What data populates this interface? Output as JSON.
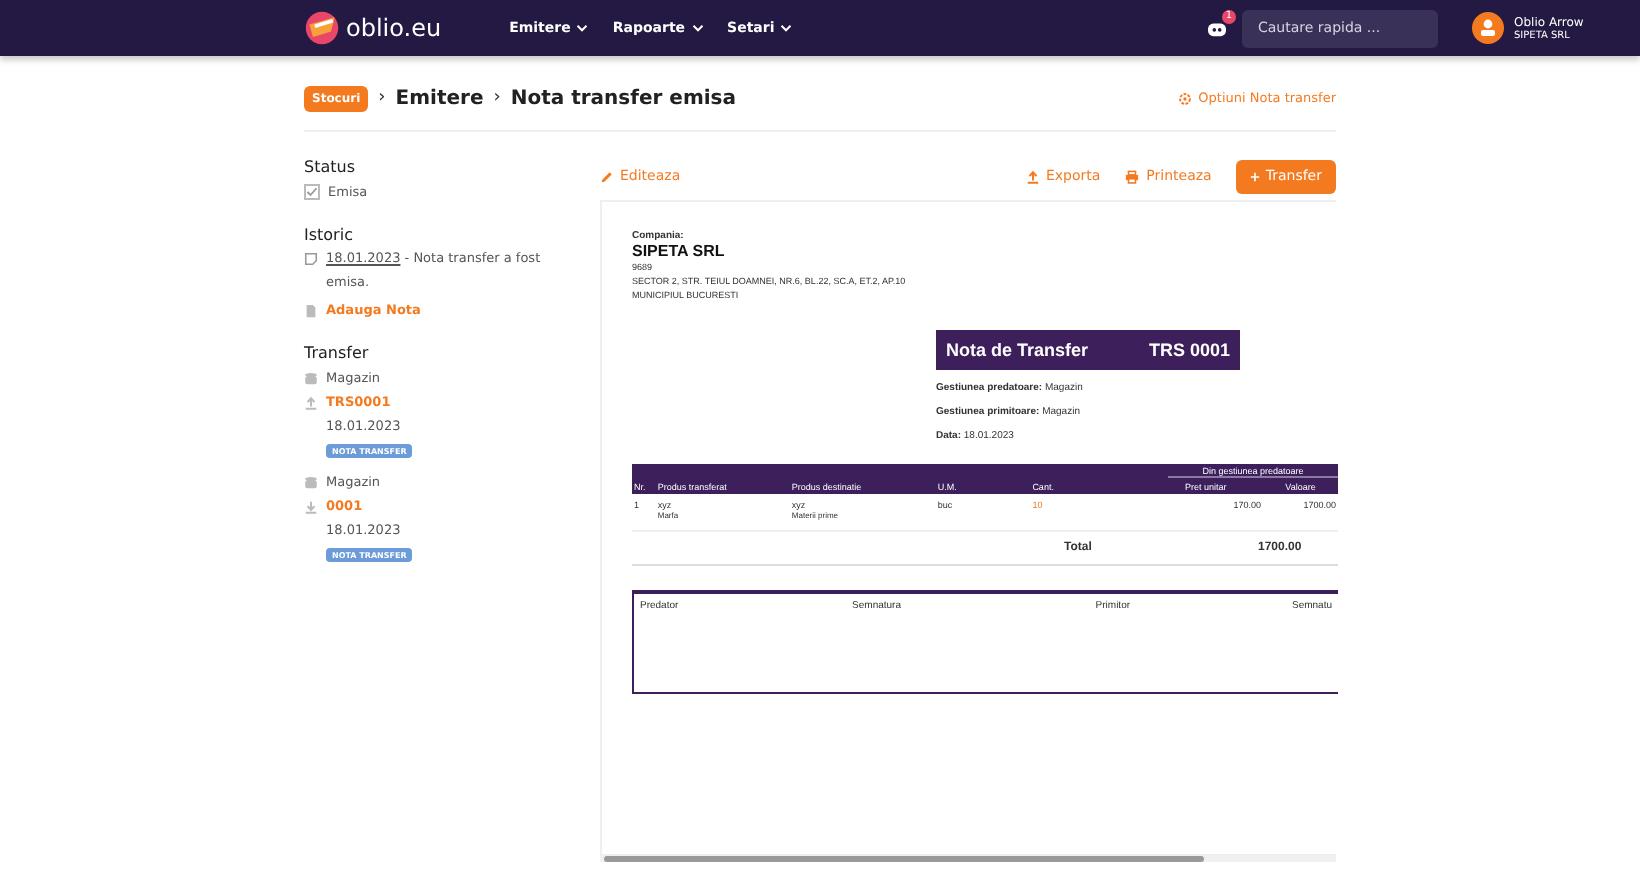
{
  "navbar": {
    "logo": "oblio.eu",
    "menus": [
      {
        "label": "Emitere"
      },
      {
        "label": "Rapoarte"
      },
      {
        "label": "Setari"
      }
    ],
    "notification_count": "1",
    "search": {
      "placeholder": "Cautare rapida ..."
    },
    "user": {
      "name": "Oblio Arrow",
      "company": "SIPETA SRL"
    }
  },
  "breadcrumb": {
    "badge": "Stocuri",
    "separator": "›",
    "items": [
      "Emitere",
      "Nota transfer emisa"
    ],
    "options_link": "Optiuni Nota transfer"
  },
  "sidebar": {
    "status": {
      "title": "Status",
      "label": "Emisa",
      "checked": true
    },
    "history": {
      "title": "Istoric",
      "date": "18.01.2023",
      "text": " - Nota transfer a fost emisa.",
      "add_note": "Adauga Nota"
    },
    "transfer": {
      "title": "Transfer",
      "entries": [
        {
          "store": "Magazin",
          "kind": "out",
          "number": "TRS0001",
          "date": "18.01.2023",
          "tag": "NOTA TRANSFER"
        },
        {
          "store": "Magazin",
          "kind": "in",
          "number": "0001",
          "date": "18.01.2023",
          "tag": "NOTA TRANSFER"
        }
      ]
    }
  },
  "toolbar": {
    "edit": "Editeaza",
    "export": "Exporta",
    "print": "Printeaza",
    "transfer": "Transfer"
  },
  "document": {
    "company_label": "Compania:",
    "company_name": "SIPETA SRL",
    "company_code": "9689",
    "address_lines": [
      "SECTOR 2, STR. TEIUL DOAMNEI, NR.6, BL.22, SC.A, ET.2, AP.10",
      "MUNICIPIUL BUCURESTI"
    ],
    "title": "Nota de Transfer",
    "number": "TRS 0001",
    "fields": [
      {
        "label": "Gestiunea predatoare:",
        "value": "Magazin"
      },
      {
        "label": "Gestiunea primitoare:",
        "value": "Magazin"
      },
      {
        "label": "Data:",
        "value": "18.01.2023"
      }
    ],
    "group_header": "Din gestiunea predatoare",
    "columns": [
      "Nr.",
      "Produs transferat",
      "Produs destinatie",
      "U.M.",
      "Cant.",
      "Pret unitar",
      "Valoare"
    ],
    "rows": [
      {
        "nr": "1",
        "product": "xyz",
        "product_type": "Marfa",
        "destination": "xyz",
        "destination_type": "Materii prime",
        "um": "buc",
        "qty": "10",
        "price": "170.00",
        "value": "1700.00"
      }
    ],
    "total_label": "Total",
    "total": "1700.00",
    "signatures": [
      "Predator",
      "Semnatura",
      "Primitor",
      "Semnatu"
    ]
  }
}
